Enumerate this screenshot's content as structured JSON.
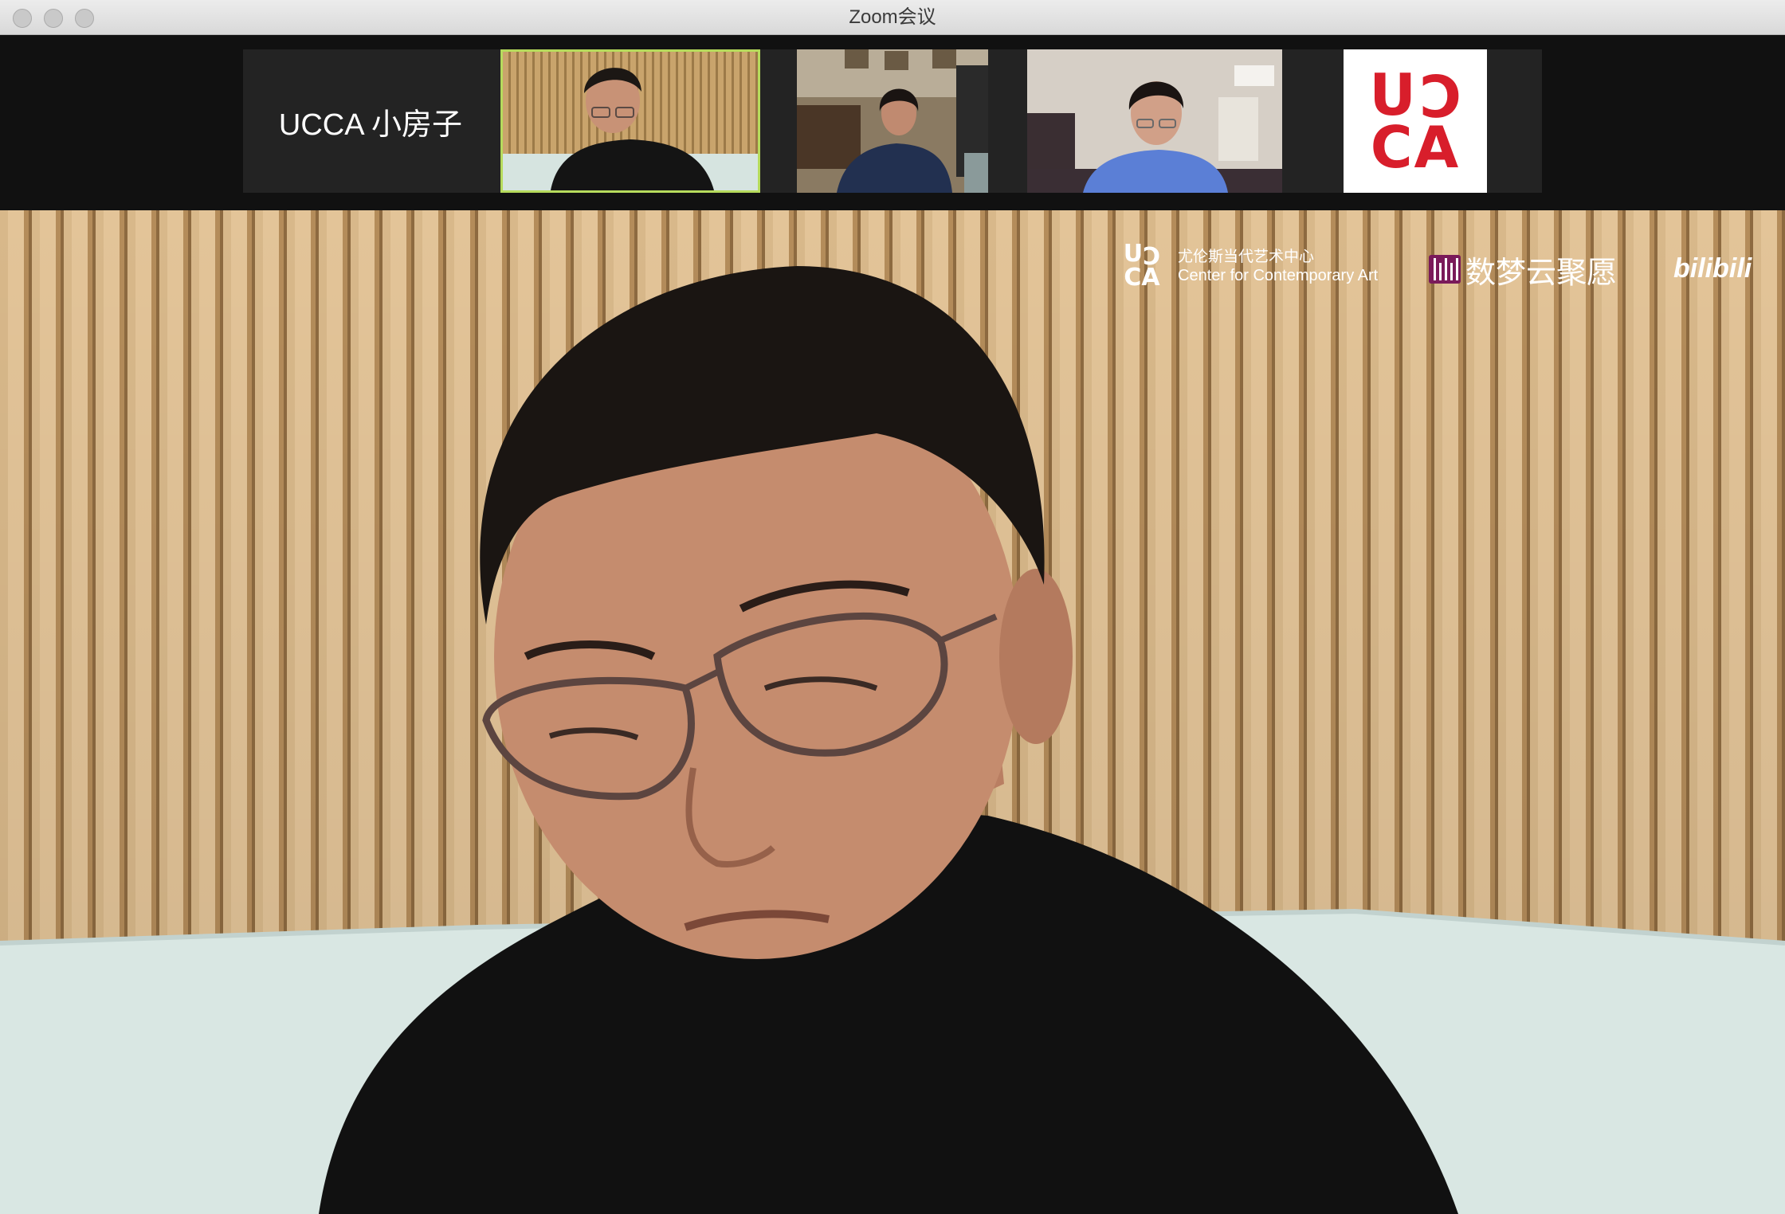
{
  "window": {
    "title": "Zoom会议"
  },
  "gallery": {
    "name_tile_label": "UCCA 小房子",
    "logo_tile_text": "UC\nCA"
  },
  "overlay": {
    "ucca_mark": "UC\nCA",
    "ucca_zh": "尤伦斯当代艺术中心",
    "ucca_en": "Center for Contemporary Art",
    "shumeng": "数梦云聚愿",
    "bilibili": "bilibili"
  },
  "colors": {
    "active_speaker_border": "#b6db5c",
    "ucca_red": "#d81e2b"
  }
}
